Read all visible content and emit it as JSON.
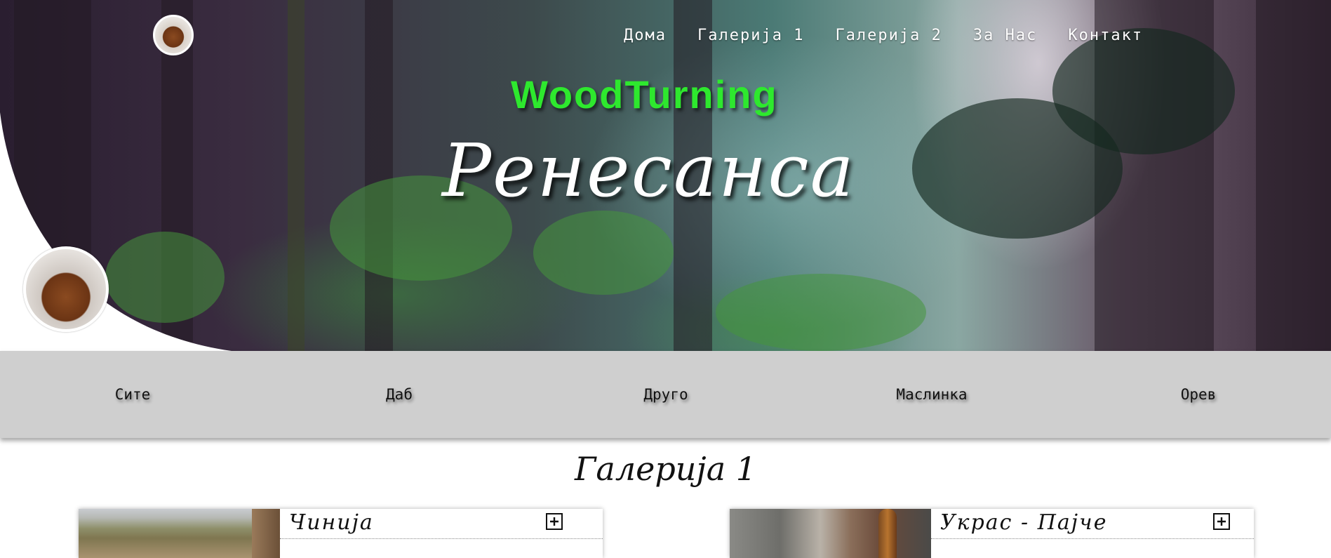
{
  "nav": {
    "items": [
      "Дома",
      "Галерија 1",
      "Галерија 2",
      "За Нас",
      "Контакт"
    ]
  },
  "hero": {
    "brand": "WoodTurning",
    "subtitle": "Ренесанса"
  },
  "filters": {
    "items": [
      "Сите",
      "Даб",
      "Друго",
      "Маслинка",
      "Орев"
    ]
  },
  "gallery": {
    "title": "Галерија 1",
    "cards": [
      {
        "title": "Чинија",
        "image": "window-view-photo"
      },
      {
        "title": "Украс - Пајче",
        "image": "room-shelf-photo"
      }
    ]
  },
  "icons": {
    "logo": "acorn-bowl-icon",
    "expand": "plus-square-icon"
  },
  "colors": {
    "brand_green": "#2ee82e",
    "filter_bar": "#cfcfcf",
    "text": "#111111"
  }
}
